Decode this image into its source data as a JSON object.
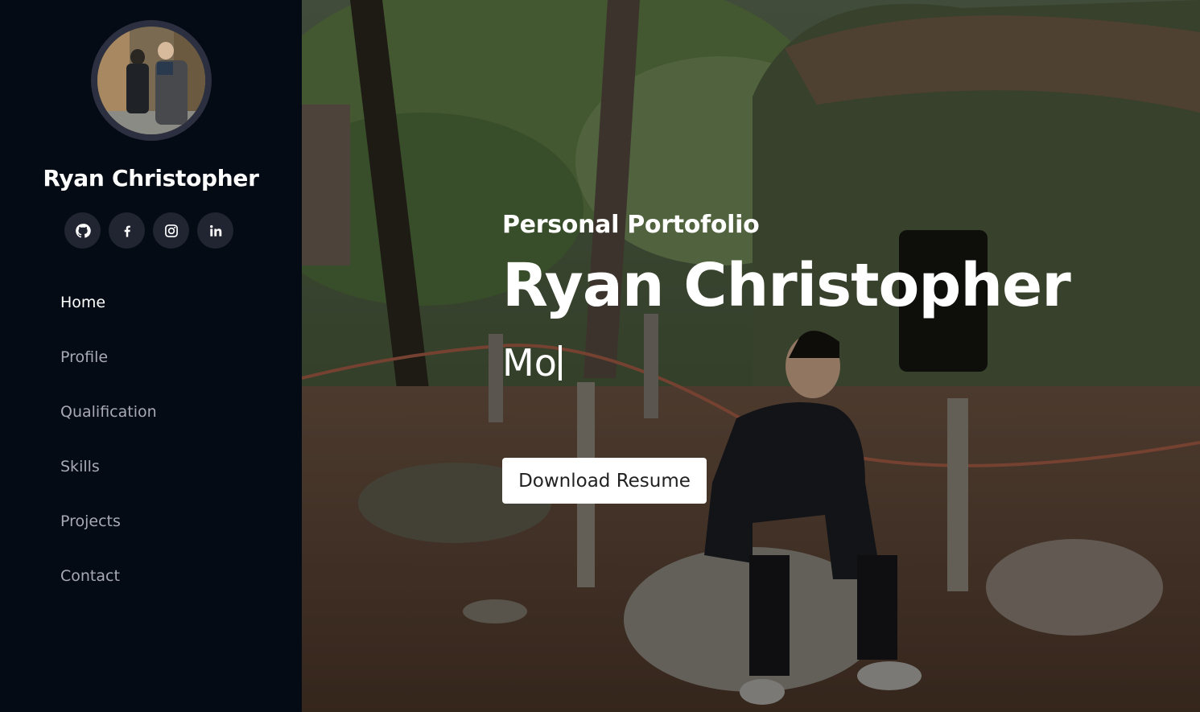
{
  "sidebar": {
    "name": "Ryan Christopher",
    "social": [
      {
        "icon": "github-icon"
      },
      {
        "icon": "facebook-icon"
      },
      {
        "icon": "instagram-icon"
      },
      {
        "icon": "linkedin-icon"
      }
    ],
    "nav": [
      {
        "label": "Home",
        "active": true
      },
      {
        "label": "Profile"
      },
      {
        "label": "Qualification"
      },
      {
        "label": "Skills"
      },
      {
        "label": "Projects"
      },
      {
        "label": "Contact"
      }
    ]
  },
  "hero": {
    "subtitle": "Personal Portofolio",
    "name": "Ryan Christopher",
    "typed_text": "Mo",
    "button_label": "Download Resume"
  },
  "colors": {
    "sidebar_bg": "#040b14",
    "social_btn_bg": "#212431",
    "nav_text": "#a8a9b4",
    "nav_active": "#ffffff"
  }
}
